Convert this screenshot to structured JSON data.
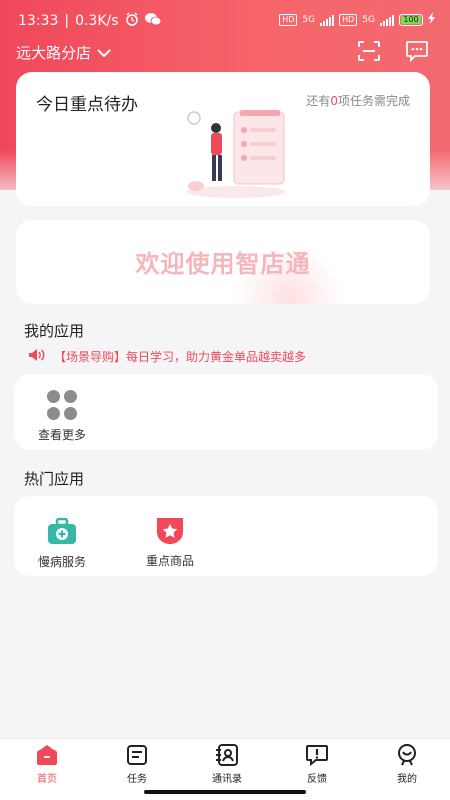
{
  "status_bar": {
    "time": "13:33",
    "speed": "0.3K/s",
    "hd1": "HD",
    "net1": "5G",
    "hd2": "HD",
    "net2": "5G",
    "battery": "100"
  },
  "header": {
    "store_name": "远大路分店"
  },
  "todo": {
    "title": "今日重点待办",
    "sub_prefix": "还有",
    "count": "0",
    "sub_suffix": "项任务需完成"
  },
  "banner": {
    "text": "欢迎使用智店通"
  },
  "my_apps": {
    "title": "我的应用",
    "notice": "【场景导购】每日学习，助力黄金单品越卖越多",
    "items": [
      {
        "label": "查看更多",
        "icon": "grid-icon"
      }
    ]
  },
  "hot_apps": {
    "title": "热门应用",
    "items": [
      {
        "label": "慢病服务",
        "icon": "medical-kit-icon"
      },
      {
        "label": "重点商品",
        "icon": "star-badge-icon"
      }
    ]
  },
  "tabbar": {
    "items": [
      {
        "label": "首页",
        "icon": "home-icon",
        "active": true
      },
      {
        "label": "任务",
        "icon": "task-icon",
        "active": false
      },
      {
        "label": "通讯录",
        "icon": "contacts-icon",
        "active": false
      },
      {
        "label": "反馈",
        "icon": "feedback-icon",
        "active": false
      },
      {
        "label": "我的",
        "icon": "profile-icon",
        "active": false
      }
    ]
  },
  "colors": {
    "brand": "#f04a5a",
    "banner_text": "#f6b5ba",
    "teal": "#37b7a8"
  }
}
